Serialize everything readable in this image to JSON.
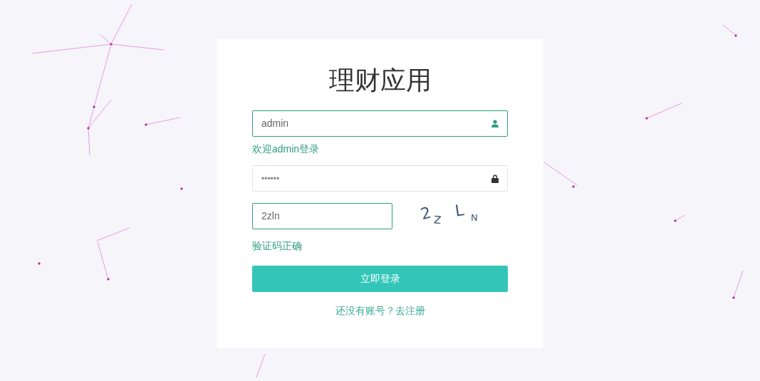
{
  "title": "理财应用",
  "fields": [
    {
      "kind": "text",
      "value": "admin",
      "valid": true,
      "message": "欢迎admin登录"
    },
    {
      "kind": "password",
      "value": "••••••",
      "valid": false
    },
    {
      "kind": "captcha",
      "value": "2zln",
      "valid": true,
      "message": "验证码正确",
      "captcha_chars": [
        "2",
        "z",
        "L",
        "N"
      ]
    }
  ],
  "submit": "立即登录",
  "register_link": "还没有账号？去注册"
}
